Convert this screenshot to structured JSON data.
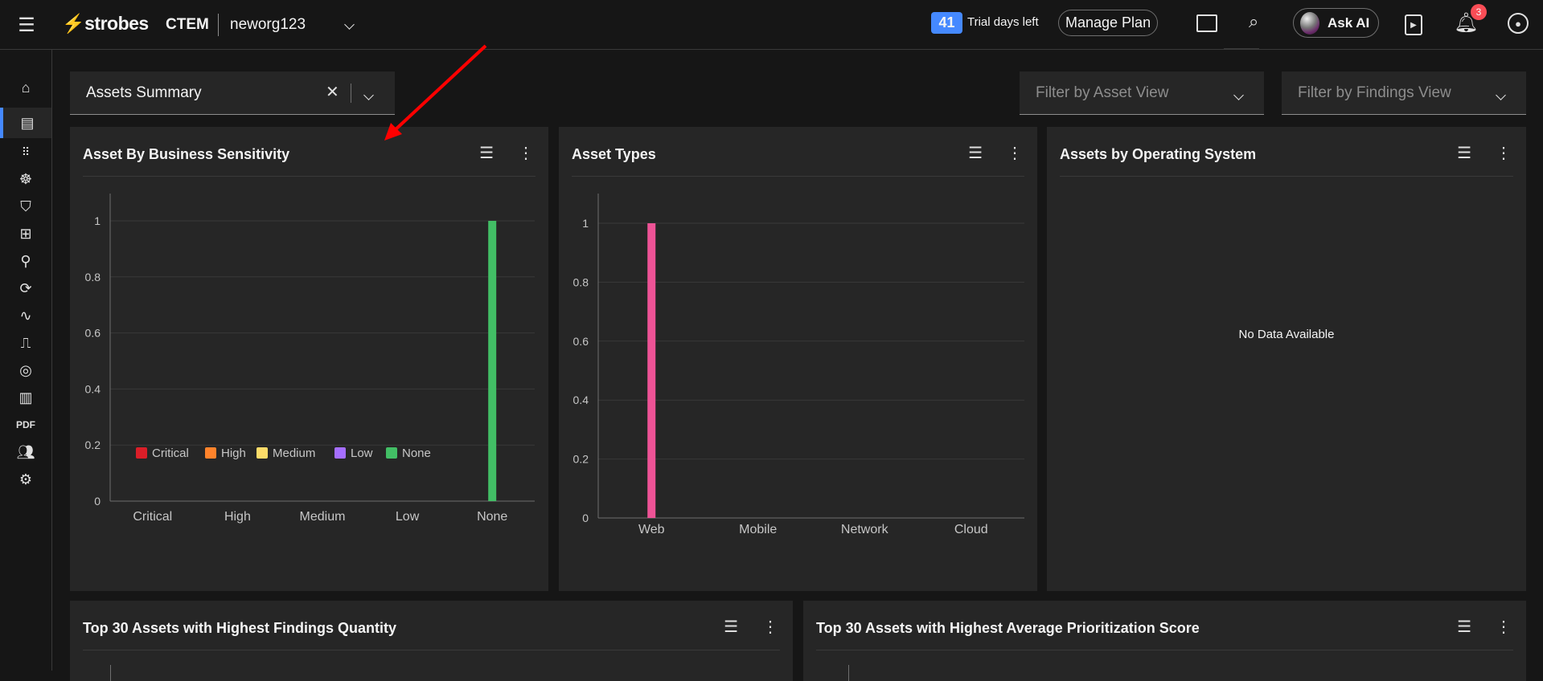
{
  "header": {
    "brand": "strobes",
    "product": "CTEM",
    "org": "neworg123",
    "trial_days": "41",
    "trial_label": "Trial days left",
    "manage_plan": "Manage Plan",
    "ask_ai": "Ask AI",
    "notification_count": "3"
  },
  "sidebar": {
    "items": [
      "home",
      "dashboard",
      "apps",
      "bug",
      "shield-check",
      "tables",
      "hierarchy",
      "refresh-gear",
      "activity",
      "ticket",
      "eye-shield",
      "report",
      "PDF",
      "users",
      "settings"
    ],
    "active": "dashboard"
  },
  "toolbar": {
    "dashboard_select": "Assets Summary",
    "asset_view_placeholder": "Filter by Asset View",
    "findings_view_placeholder": "Filter by Findings View"
  },
  "panels": {
    "sensitivity": {
      "title": "Asset By Business Sensitivity"
    },
    "types": {
      "title": "Asset Types"
    },
    "os": {
      "title": "Assets by Operating System",
      "empty": "No Data Available"
    },
    "top_findings": {
      "title": "Top 30 Assets with Highest Findings Quantity"
    },
    "top_score": {
      "title": "Top 30 Assets with Highest Average Prioritization Score"
    }
  },
  "chart_data": [
    {
      "type": "bar",
      "title": "Asset By Business Sensitivity",
      "categories": [
        "Critical",
        "High",
        "Medium",
        "Low",
        "None"
      ],
      "values": [
        0,
        0,
        0,
        0,
        1
      ],
      "colors": [
        "#da1e28",
        "#ff832b",
        "#fddc69",
        "#a56eff",
        "#42be65"
      ],
      "ylim": [
        0,
        1
      ],
      "yticks": [
        "0",
        "0.2",
        "0.4",
        "0.6",
        "0.8",
        "1"
      ],
      "legend": [
        "Critical",
        "High",
        "Medium",
        "Low",
        "None"
      ],
      "legend_position": "bottom",
      "grid": true
    },
    {
      "type": "bar",
      "title": "Asset Types",
      "categories": [
        "Web",
        "Mobile",
        "Network",
        "Cloud"
      ],
      "values": [
        1,
        0,
        0,
        0
      ],
      "colors": [
        "#ee5396",
        "#ee5396",
        "#ee5396",
        "#ee5396"
      ],
      "ylim": [
        0,
        1
      ],
      "yticks": [
        "0",
        "0.2",
        "0.4",
        "0.6",
        "0.8",
        "1"
      ],
      "grid": true
    }
  ]
}
